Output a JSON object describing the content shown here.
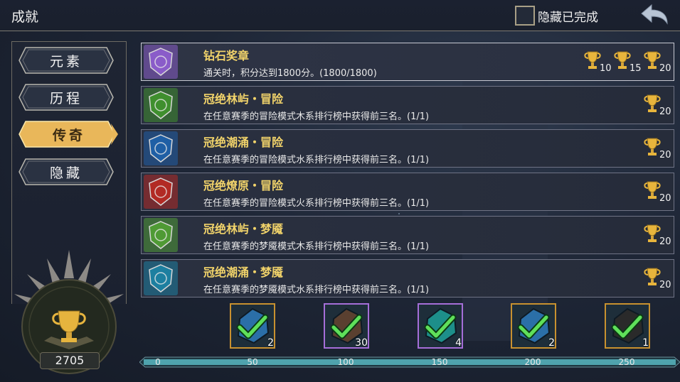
{
  "header": {
    "title": "成就",
    "hide_completed_label": "隐藏已完成"
  },
  "sidebar": {
    "tabs": [
      {
        "label": "元素",
        "active": false
      },
      {
        "label": "历程",
        "active": false
      },
      {
        "label": "传奇",
        "active": true
      },
      {
        "label": "隐藏",
        "active": false
      }
    ],
    "score": "2705"
  },
  "achievements": [
    {
      "title": "钻石奖章",
      "desc": "通关时，积分达到1800分。(1800/1800)",
      "color": "#8a5cc9",
      "icon": "diamond-icon",
      "trophies": [
        "10",
        "15",
        "20"
      ]
    },
    {
      "title": "冠绝林屿・冒险",
      "desc": "在任意赛季的冒险模式木系排行榜中获得前三名。(1/1)",
      "color": "#3f8f2e",
      "icon": "leaf-shield-icon",
      "trophies": [
        "20"
      ]
    },
    {
      "title": "冠绝潮涌・冒险",
      "desc": "在任意赛季的冒险模式水系排行榜中获得前三名。(1/1)",
      "color": "#1f5fa5",
      "icon": "water-shield-icon",
      "trophies": [
        "20"
      ]
    },
    {
      "title": "冠绝燎原・冒险",
      "desc": "在任意赛季的冒险模式火系排行榜中获得前三名。(1/1)",
      "color": "#b22a24",
      "icon": "fire-shield-icon",
      "trophies": [
        "20"
      ]
    },
    {
      "title": "冠绝林屿・梦魇",
      "desc": "在任意赛季的梦魇模式木系排行榜中获得前三名。(1/1)",
      "color": "#4f9a34",
      "icon": "leaf-star-icon",
      "trophies": [
        "20"
      ]
    },
    {
      "title": "冠绝潮涌・梦魇",
      "desc": "在任意赛季的梦魇模式水系排行榜中获得前三名。(1/1)",
      "color": "#1d7fa0",
      "icon": "water-star-icon",
      "trophies": [
        "20"
      ]
    }
  ],
  "rewards": [
    {
      "count": "2",
      "rarity": "gold",
      "icon": "blue-crystal-icon"
    },
    {
      "count": "30",
      "rarity": "purple",
      "icon": "warrior-portrait-icon"
    },
    {
      "count": "4",
      "rarity": "purple",
      "icon": "teal-crystal-icon"
    },
    {
      "count": "2",
      "rarity": "gold",
      "icon": "blue-crystal-icon"
    },
    {
      "count": "1",
      "rarity": "gold",
      "icon": "arrows-quiver-icon"
    }
  ],
  "progress": {
    "ticks": [
      "0",
      "50",
      "100",
      "150",
      "200",
      "250"
    ],
    "value": 2705
  },
  "colors": {
    "gold_accent": "#f1d36a",
    "tab_active": "#e9b75a",
    "progress_fill": "#4fa3ad"
  }
}
